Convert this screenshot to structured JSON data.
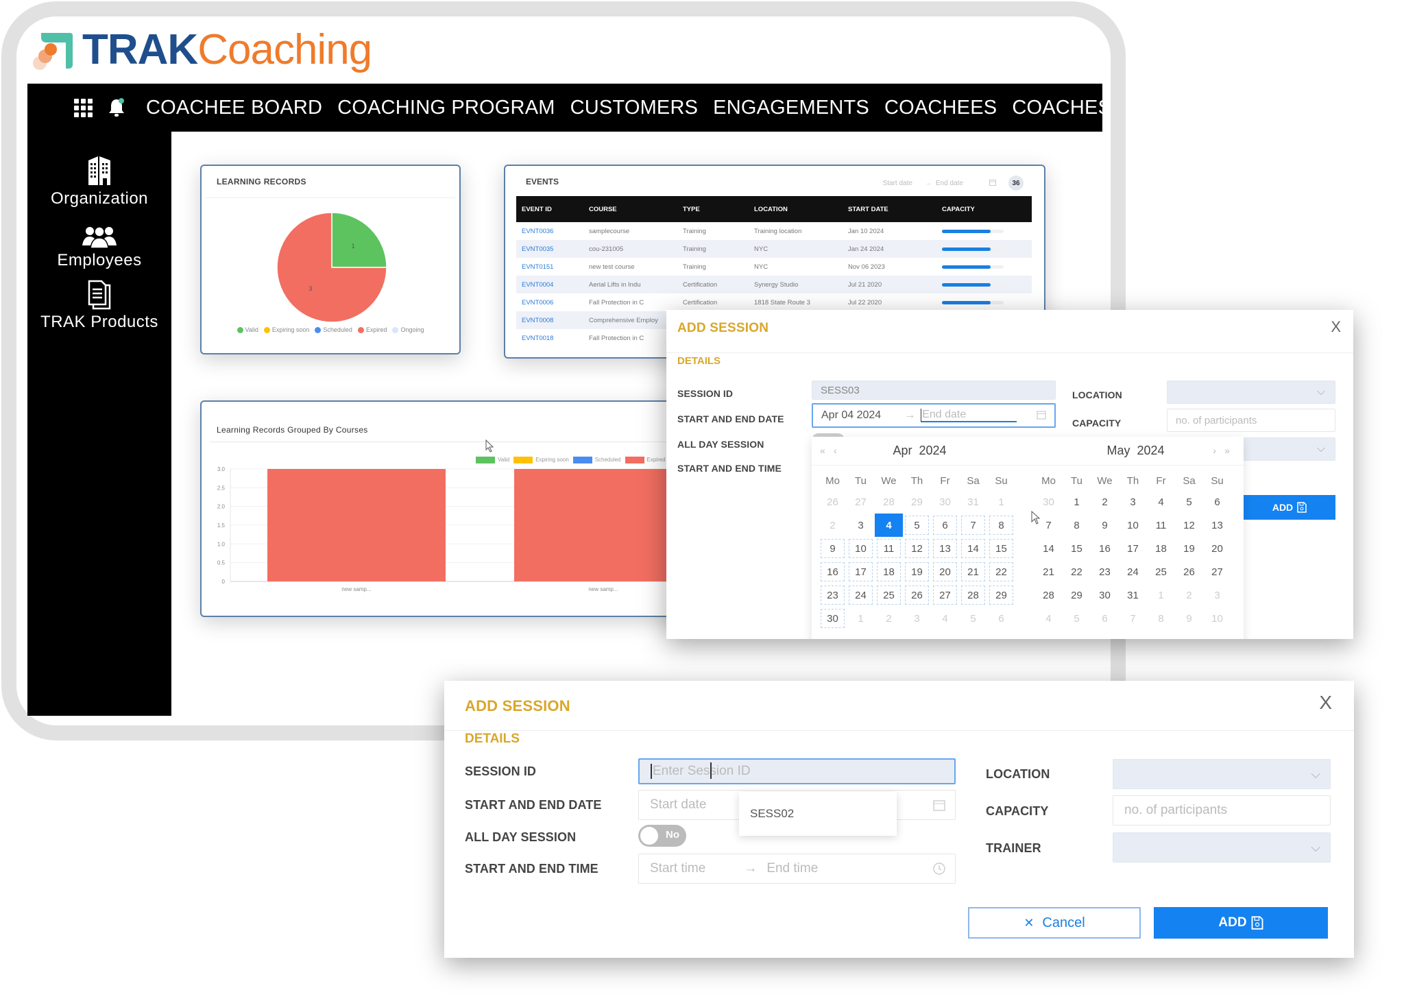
{
  "brand": {
    "name_part1": "TRAK",
    "name_part2": "Coaching",
    "primary_color": "#1f4e8c",
    "accent_color": "#ef7b2b",
    "mark_color": "#4fbfa8"
  },
  "topnav": {
    "icons": [
      "apps-grid-icon",
      "notification-bell-icon"
    ],
    "items": [
      {
        "label": "COACHEE BOARD"
      },
      {
        "label": "COACHING PROGRAM"
      },
      {
        "label": "CUSTOMERS"
      },
      {
        "label": "ENGAGEMENTS"
      },
      {
        "label": "COACHEES"
      },
      {
        "label": "COACHES"
      }
    ]
  },
  "sidebar": {
    "items": [
      {
        "label": "Organization",
        "icon": "building-icon"
      },
      {
        "label": "Employees",
        "icon": "users-icon"
      },
      {
        "label": "TRAK Products",
        "icon": "documents-icon"
      }
    ]
  },
  "learning_records": {
    "title": "LEARNING RECORDS",
    "legend": [
      {
        "label": "Valid",
        "color": "#5cc35f"
      },
      {
        "label": "Expiring soon",
        "color": "#ffc107"
      },
      {
        "label": "Scheduled",
        "color": "#4a8df0"
      },
      {
        "label": "Expired",
        "color": "#f26e61"
      },
      {
        "label": "Ongoing",
        "color": "#d8e6fb"
      }
    ]
  },
  "events": {
    "title": "EVENTS",
    "start_placeholder": "Start date",
    "end_placeholder": "End date",
    "count": "36",
    "columns": [
      "EVENT ID",
      "COURSE",
      "TYPE",
      "LOCATION",
      "START DATE",
      "CAPACITY"
    ],
    "rows": [
      {
        "id": "EVNT0036",
        "course": "samplecourse",
        "type": "Training",
        "location": "Training location",
        "start": "Jan 10 2024",
        "capacity": 0.79
      },
      {
        "id": "EVNT0035",
        "course": "cou-231005",
        "type": "Training",
        "location": "NYC",
        "start": "Jan 24 2024",
        "capacity": 0.79
      },
      {
        "id": "EVNT0151",
        "course": "new test course",
        "type": "Training",
        "location": "NYC",
        "start": "Nov 06 2023",
        "capacity": 0.79
      },
      {
        "id": "EVNT0004",
        "course": "Aerial Lifts in Indu",
        "type": "Certification",
        "location": "Synergy Studio",
        "start": "Jul 21 2020",
        "capacity": 0.79
      },
      {
        "id": "EVNT0006",
        "course": "Fall Protection in C",
        "type": "Certification",
        "location": "1818 State Route 3",
        "start": "Jul 22 2020",
        "capacity": 0.79
      },
      {
        "id": "EVNT0008",
        "course": "Comprehensive Employ",
        "type": "",
        "location": "",
        "start": "",
        "capacity": null
      },
      {
        "id": "EVNT0018",
        "course": "Fall Protection in C",
        "type": "",
        "location": "",
        "start": "",
        "capacity": null
      }
    ]
  },
  "chart_data": [
    {
      "type": "pie",
      "title": "LEARNING RECORDS",
      "categories": [
        "Valid",
        "Expiring soon",
        "Scheduled",
        "Expired",
        "Ongoing"
      ],
      "values": [
        1,
        0,
        0,
        3,
        0
      ],
      "colors": [
        "#5cc35f",
        "#ffc107",
        "#4a8df0",
        "#f26e61",
        "#d8e6fb"
      ],
      "data_labels": [
        "1",
        "",
        "",
        "3",
        ""
      ],
      "legend": "bottom"
    },
    {
      "type": "bar",
      "title": "Learning Records Grouped By Courses",
      "categories": [
        "new samp...",
        "new samp..."
      ],
      "series": [
        {
          "name": "Valid",
          "color": "#5cc35f",
          "values": [
            0,
            0
          ]
        },
        {
          "name": "Expiring soon",
          "color": "#ffc107",
          "values": [
            0,
            0
          ]
        },
        {
          "name": "Scheduled",
          "color": "#4a8df0",
          "values": [
            0,
            0
          ]
        },
        {
          "name": "Expired",
          "color": "#f26e61",
          "values": [
            3,
            3
          ]
        }
      ],
      "yticks": [
        "0",
        "0.5",
        "1.0",
        "1.5",
        "2.0",
        "2.5",
        "3.0"
      ],
      "ylim": [
        0,
        3
      ],
      "grid": true,
      "legend": "top-right",
      "xlabel": "",
      "ylabel": ""
    }
  ],
  "modal_calendar": {
    "title": "ADD SESSION",
    "section": "DETAILS",
    "labels": {
      "session_id": "SESSION ID",
      "dates": "START AND END DATE",
      "all_day": "ALL DAY SESSION",
      "times": "START AND END TIME",
      "location": "LOCATION",
      "capacity": "CAPACITY"
    },
    "session_id_value": "SESS03",
    "start_date_value": "Apr 04 2024",
    "end_date_placeholder": "End date",
    "capacity_placeholder": "no. of participants",
    "add_label": "ADD",
    "close_glyph": "X",
    "calendar": {
      "weekdays": [
        "Mo",
        "Tu",
        "We",
        "Th",
        "Fr",
        "Sa",
        "Su"
      ],
      "left": {
        "month": "Apr",
        "year": "2024",
        "days": [
          "26",
          "27",
          "28",
          "29",
          "30",
          "31",
          "1",
          "2",
          "3",
          "4",
          "5",
          "6",
          "7",
          "8",
          "9",
          "10",
          "11",
          "12",
          "13",
          "14",
          "15",
          "16",
          "17",
          "18",
          "19",
          "20",
          "21",
          "22",
          "23",
          "24",
          "25",
          "26",
          "27",
          "28",
          "29",
          "30",
          "1",
          "2",
          "3",
          "4",
          "5",
          "6"
        ],
        "muted_before": 8,
        "muted_after_index": 36,
        "selected": "4"
      },
      "right": {
        "month": "May",
        "year": "2024",
        "days": [
          "30",
          "1",
          "2",
          "3",
          "4",
          "5",
          "6",
          "7",
          "8",
          "9",
          "10",
          "11",
          "12",
          "13",
          "14",
          "15",
          "16",
          "17",
          "18",
          "19",
          "20",
          "21",
          "22",
          "23",
          "24",
          "25",
          "26",
          "27",
          "28",
          "29",
          "30",
          "31",
          "1",
          "2",
          "3",
          "4",
          "5",
          "6",
          "7",
          "8",
          "9",
          "10"
        ],
        "muted_before": 1,
        "muted_after_index": 32
      }
    }
  },
  "modal_form": {
    "title": "ADD SESSION",
    "section": "DETAILS",
    "labels": {
      "session_id": "SESSION ID",
      "dates": "START AND END DATE",
      "all_day": "ALL DAY SESSION",
      "times": "START AND END TIME",
      "location": "LOCATION",
      "capacity": "CAPACITY",
      "trainer": "TRAINER"
    },
    "session_id_placeholder": "Enter Session ID",
    "start_date_placeholder": "Start date",
    "start_time_placeholder": "Start time",
    "end_time_placeholder": "End time",
    "capacity_placeholder": "no. of participants",
    "all_day_toggle": "No",
    "suggestion": "SESS02",
    "cancel_label": "Cancel",
    "add_label": "ADD",
    "close_glyph": "X"
  }
}
